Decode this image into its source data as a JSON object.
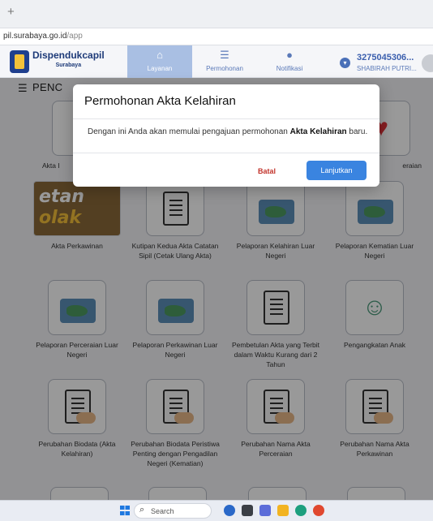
{
  "browser": {
    "new_tab": "+",
    "url_host": "pil.surabaya.go.id",
    "url_path": "/app"
  },
  "header": {
    "brand_name": "Dispendukcapil",
    "brand_sub": "Surabaya",
    "nav": [
      {
        "label": "Layanan",
        "icon": "home-icon",
        "active": true
      },
      {
        "label": "Permohonan",
        "icon": "list-icon",
        "active": false
      },
      {
        "label": "Notifikasi",
        "icon": "bell-icon",
        "active": false
      }
    ],
    "user_id": "3275045306...",
    "user_name": "SHABIRAH PUTRI..."
  },
  "section": {
    "title": "PENC"
  },
  "services": [
    {
      "label": "Akta I",
      "icon": "baby-icon"
    },
    {
      "label": "eraian",
      "icon": "heart-icon"
    },
    {
      "label": "Akta Perkawinan",
      "icon": "wedding-photo"
    },
    {
      "label": "Kutipan Kedua Akta Catatan Sipil (Cetak Ulang Akta)",
      "icon": "document-icon"
    },
    {
      "label": "Pelaporan Kelahiran Luar Negeri",
      "icon": "baby-map-icon"
    },
    {
      "label": "Pelaporan Kematian Luar Negeri",
      "icon": "certificate-map-icon"
    },
    {
      "label": "Pelaporan Perceraian Luar Negeri",
      "icon": "broken-heart-map-icon"
    },
    {
      "label": "Pelaporan Perkawinan Luar Negeri",
      "icon": "rings-map-icon"
    },
    {
      "label": "Pembetulan Akta yang Terbit dalam Waktu Kurang dari 2 Tahun",
      "icon": "document-search-icon"
    },
    {
      "label": "Pengangkatan Anak",
      "icon": "child-hand-icon"
    },
    {
      "label": "Perubahan Biodata (Akta Kelahiran)",
      "icon": "clipboard-sign-icon"
    },
    {
      "label": "Perubahan Biodata Peristiwa Penting dengan Pengadilan Negeri (Kematian)",
      "icon": "handshake-doc-icon"
    },
    {
      "label": "Perubahan Nama Akta Perceraian",
      "icon": "clipboard-sign-icon"
    },
    {
      "label": "Perubahan Nama Akta Perkawinan",
      "icon": "clipboard-sign-icon"
    }
  ],
  "photo_text": {
    "line1": "etan",
    "line2": "olak"
  },
  "modal": {
    "title": "Permohonan Akta Kelahiran",
    "body_prefix": "Dengan ini Anda akan memulai pengajuan permohonan ",
    "body_bold": "Akta Kelahiran",
    "body_suffix": " baru.",
    "cancel_label": "Batal",
    "ok_label": "Lanjutkan"
  },
  "taskbar": {
    "search_placeholder": "Search"
  },
  "colors": {
    "primary": "#3a84e0",
    "danger": "#c2332b",
    "nav_active": "#a9bfe3",
    "brand": "#1d3a78"
  }
}
